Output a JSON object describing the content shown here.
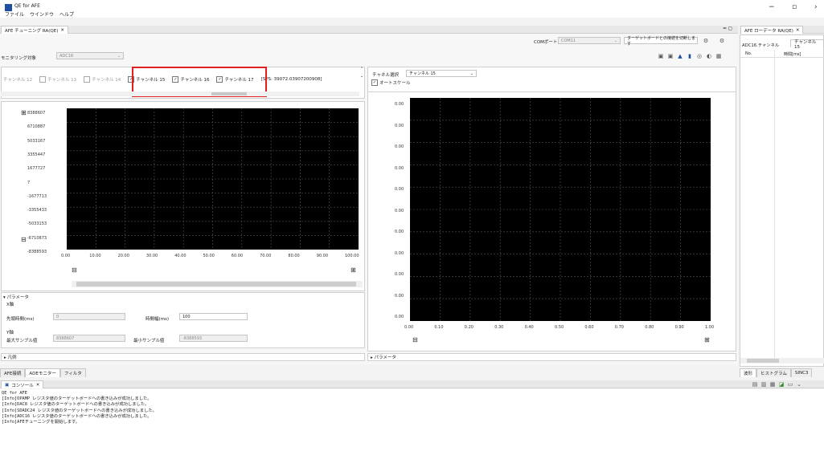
{
  "app": {
    "title": "QE for AFE",
    "menu": [
      "ファイル",
      "ウインドウ",
      "ヘルプ"
    ],
    "win_minimize": "−",
    "win_maximize": "▫",
    "win_close": "›"
  },
  "tuning": {
    "tab_label": "AFE チューニング RA(QE)",
    "com_label": "COMポート:",
    "com_value": "COM11",
    "connect_button": "ターゲットボードとの接続を切断します",
    "monitor_label": "モニタリング対象",
    "monitor_value": "ADC16",
    "channels": [
      {
        "label": "チャンネル 12",
        "checked": false
      },
      {
        "label": "チャンネル 13",
        "checked": false
      },
      {
        "label": "チャンネル 14",
        "checked": false
      },
      {
        "label": "チャンネル 15",
        "checked": true
      },
      {
        "label": "チャンネル 16",
        "checked": true
      },
      {
        "label": "チャンネル 17",
        "checked": true
      }
    ],
    "sps_text": "[SPS: 39072.03907200908]",
    "left_plot": {
      "y_ticks": [
        "8388607",
        "6710887",
        "5033167",
        "3355447",
        "1677727",
        "7",
        "-1677713",
        "-3355433",
        "-5033153",
        "-6710873",
        "-8388593"
      ],
      "x_ticks": [
        "0.00",
        "10.00",
        "20.00",
        "30.00",
        "40.00",
        "50.00",
        "60.00",
        "70.00",
        "80.00",
        "90.00",
        "100.00"
      ]
    },
    "params": {
      "header": "パラメータ",
      "x_axis": "X軸",
      "lead_time_label": "先頭時間(ms)",
      "lead_time_value": "0",
      "time_width_label": "時間幅(ms)",
      "time_width_value": "100",
      "y_axis": "Y軸",
      "max_label": "最大サンプル値",
      "max_value": "8388607",
      "min_label": "最小サンプル値",
      "min_value": "-8388593"
    },
    "legend": "凡例",
    "channel_select_label": "チャネル選択",
    "channel_select_value": "チャンネル 15",
    "auto_scale": "オートスケール",
    "right_plot": {
      "y_ticks": [
        "0.00",
        "0.00",
        "0.00",
        "0.00",
        "0.00",
        "0.00",
        "0.00",
        "0.00",
        "0.00",
        "0.00",
        "0.00"
      ],
      "x_ticks": [
        "0.00",
        "0.10",
        "0.20",
        "0.30",
        "0.40",
        "0.50",
        "0.60",
        "0.70",
        "0.80",
        "0.90",
        "1.00"
      ]
    },
    "right_params": "パラメータ",
    "bottom_tabs": [
      "AFE接続",
      "ADEモニター",
      "フィルタ"
    ]
  },
  "loader": {
    "tab_label": "AFE ローデータ RA(QE)",
    "channel_label": "ADC16.チャンネル",
    "channel_value": "チャンネル 15",
    "col_no": "No.",
    "col_time": "時間[ms]",
    "tabs": [
      "波形",
      "ヒストグラム",
      "SINC3"
    ]
  },
  "console": {
    "tab_label": "コンソール",
    "title": "QE for AFE",
    "lines": [
      "[Info]OPAMP レジスタ値のターゲットボードへの書き込みが成功しました。",
      "[Info]DAC8 レジスタ値のターゲットボードへの書き込みが成功しました。",
      "[Info]SDADC24 レジスタ値のターゲットボードへの書き込みが成功しました。",
      "[Info]ADC16 レジスタ値のターゲットボードへの書き込みが成功しました。",
      "[Info]AFEチューニングを開始します。"
    ]
  },
  "colors": {
    "highlight": "#e02020",
    "plot_bg": "#000000",
    "accent": "#1e4fa0"
  }
}
